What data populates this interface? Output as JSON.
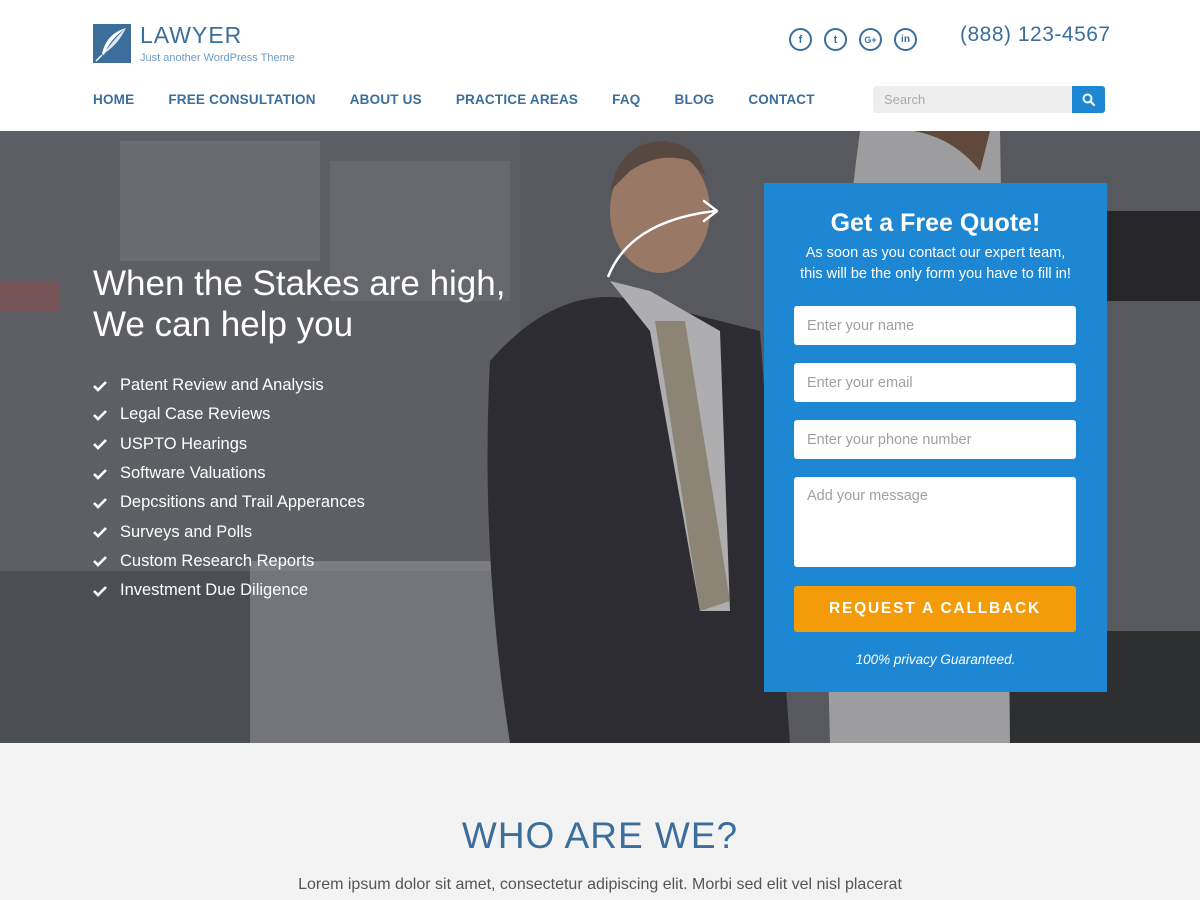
{
  "brand": {
    "title": "LAWYER",
    "tagline": "Just another WordPress Theme",
    "color": "#3b6e9b"
  },
  "social": [
    {
      "icon": "facebook-icon",
      "glyph": "f"
    },
    {
      "icon": "twitter-icon",
      "glyph": "t"
    },
    {
      "icon": "google-plus-icon",
      "glyph": "G+"
    },
    {
      "icon": "linkedin-icon",
      "glyph": "in"
    }
  ],
  "phone": "(888) 123-4567",
  "nav": [
    "HOME",
    "FREE CONSULTATION",
    "ABOUT US",
    "PRACTICE AREAS",
    "FAQ",
    "BLOG",
    "CONTACT"
  ],
  "search": {
    "placeholder": "Search",
    "icon": "search-icon"
  },
  "hero": {
    "title_line1": "When the Stakes are high,",
    "title_line2": "We can help you",
    "features": [
      "Patent Review and Analysis",
      "Legal Case Reviews",
      "USPTO Hearings",
      "Software Valuations",
      "Depcsitions and Trail Apperances",
      "Surveys and Polls",
      "Custom Research Reports",
      "Investment Due Diligence"
    ]
  },
  "quote": {
    "title": "Get a Free Quote!",
    "subtitle_line1": "As soon as you contact our expert team,",
    "subtitle_line2": "this will be the only form you have to fill in!",
    "name_placeholder": "Enter your name",
    "email_placeholder": "Enter your email",
    "phone_placeholder": "Enter your phone number",
    "message_placeholder": "Add your message",
    "button": "REQUEST A CALLBACK",
    "privacy": "100% privacy Guaranteed.",
    "bg_color": "#1d87d4",
    "button_color": "#f49b0a"
  },
  "who": {
    "title": "WHO ARE WE?",
    "text": "Lorem ipsum dolor sit amet, consectetur adipiscing elit. Morbi sed elit vel nisl placerat"
  }
}
